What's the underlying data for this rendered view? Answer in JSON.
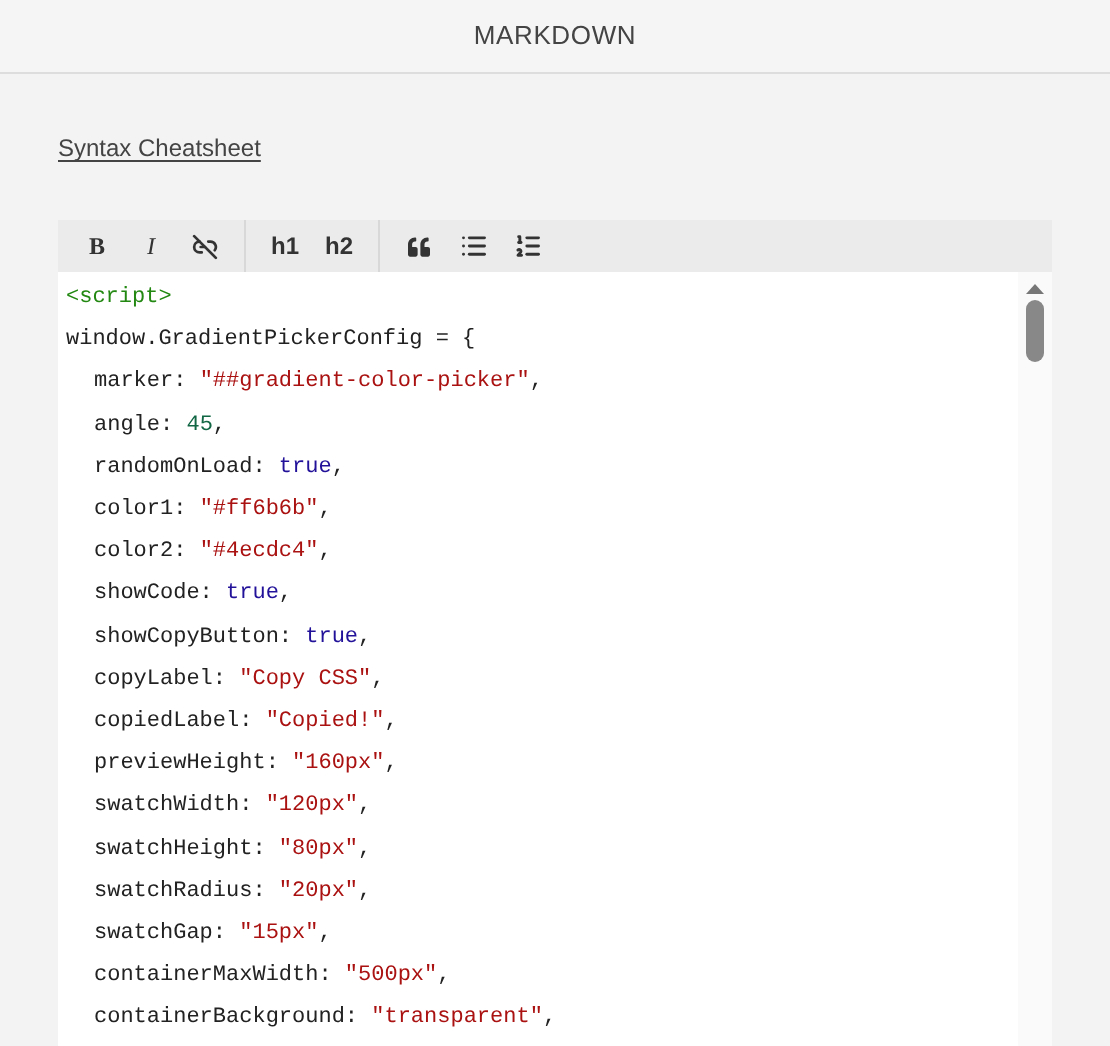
{
  "header": {
    "title": "MARKDOWN"
  },
  "link": {
    "label": "Syntax Cheatsheet"
  },
  "toolbar": [
    [
      {
        "kind": "bold",
        "label": "B"
      },
      {
        "kind": "italic",
        "label": "I"
      },
      {
        "kind": "unlink"
      }
    ],
    [
      {
        "kind": "heading",
        "label": "h1"
      },
      {
        "kind": "heading",
        "label": "h2"
      }
    ],
    [
      {
        "kind": "quote"
      },
      {
        "kind": "bullets"
      },
      {
        "kind": "numbers"
      }
    ]
  ],
  "code_lines": [
    {
      "indented": false,
      "tokens": [
        {
          "kind": "tag",
          "text": "<script>"
        }
      ]
    },
    {
      "indented": false,
      "tokens": [
        {
          "kind": "plain",
          "text": "window.GradientPickerConfig = {"
        }
      ]
    },
    {
      "indented": true,
      "tokens": [
        {
          "kind": "plain",
          "text": "marker: "
        },
        {
          "kind": "string",
          "text": "\"##gradient-color-picker\""
        },
        {
          "kind": "plain",
          "text": ","
        }
      ]
    },
    {
      "indented": true,
      "tokens": [
        {
          "kind": "plain",
          "text": "angle: "
        },
        {
          "kind": "number",
          "text": "45"
        },
        {
          "kind": "plain",
          "text": ","
        }
      ]
    },
    {
      "indented": true,
      "tokens": [
        {
          "kind": "plain",
          "text": "randomOnLoad: "
        },
        {
          "kind": "keyword",
          "text": "true"
        },
        {
          "kind": "plain",
          "text": ","
        }
      ]
    },
    {
      "indented": true,
      "tokens": [
        {
          "kind": "plain",
          "text": "color1: "
        },
        {
          "kind": "string",
          "text": "\"#ff6b6b\""
        },
        {
          "kind": "plain",
          "text": ","
        }
      ]
    },
    {
      "indented": true,
      "tokens": [
        {
          "kind": "plain",
          "text": "color2: "
        },
        {
          "kind": "string",
          "text": "\"#4ecdc4\""
        },
        {
          "kind": "plain",
          "text": ","
        }
      ]
    },
    {
      "indented": true,
      "tokens": [
        {
          "kind": "plain",
          "text": "showCode: "
        },
        {
          "kind": "keyword",
          "text": "true"
        },
        {
          "kind": "plain",
          "text": ","
        }
      ]
    },
    {
      "indented": true,
      "tokens": [
        {
          "kind": "plain",
          "text": "showCopyButton: "
        },
        {
          "kind": "keyword",
          "text": "true"
        },
        {
          "kind": "plain",
          "text": ","
        }
      ]
    },
    {
      "indented": true,
      "tokens": [
        {
          "kind": "plain",
          "text": "copyLabel: "
        },
        {
          "kind": "string",
          "text": "\"Copy CSS\""
        },
        {
          "kind": "plain",
          "text": ","
        }
      ]
    },
    {
      "indented": true,
      "tokens": [
        {
          "kind": "plain",
          "text": "copiedLabel: "
        },
        {
          "kind": "string",
          "text": "\"Copied!\""
        },
        {
          "kind": "plain",
          "text": ","
        }
      ]
    },
    {
      "indented": true,
      "tokens": [
        {
          "kind": "plain",
          "text": "previewHeight: "
        },
        {
          "kind": "string",
          "text": "\"160px\""
        },
        {
          "kind": "plain",
          "text": ","
        }
      ]
    },
    {
      "indented": true,
      "tokens": [
        {
          "kind": "plain",
          "text": "swatchWidth: "
        },
        {
          "kind": "string",
          "text": "\"120px\""
        },
        {
          "kind": "plain",
          "text": ","
        }
      ]
    },
    {
      "indented": true,
      "tokens": [
        {
          "kind": "plain",
          "text": "swatchHeight: "
        },
        {
          "kind": "string",
          "text": "\"80px\""
        },
        {
          "kind": "plain",
          "text": ","
        }
      ]
    },
    {
      "indented": true,
      "tokens": [
        {
          "kind": "plain",
          "text": "swatchRadius: "
        },
        {
          "kind": "string",
          "text": "\"20px\""
        },
        {
          "kind": "plain",
          "text": ","
        }
      ]
    },
    {
      "indented": true,
      "tokens": [
        {
          "kind": "plain",
          "text": "swatchGap: "
        },
        {
          "kind": "string",
          "text": "\"15px\""
        },
        {
          "kind": "plain",
          "text": ","
        }
      ]
    },
    {
      "indented": true,
      "tokens": [
        {
          "kind": "plain",
          "text": "containerMaxWidth: "
        },
        {
          "kind": "string",
          "text": "\"500px\""
        },
        {
          "kind": "plain",
          "text": ","
        }
      ]
    },
    {
      "indented": true,
      "tokens": [
        {
          "kind": "plain",
          "text": "containerBackground: "
        },
        {
          "kind": "string",
          "text": "\"transparent\""
        },
        {
          "kind": "plain",
          "text": ","
        }
      ]
    }
  ]
}
